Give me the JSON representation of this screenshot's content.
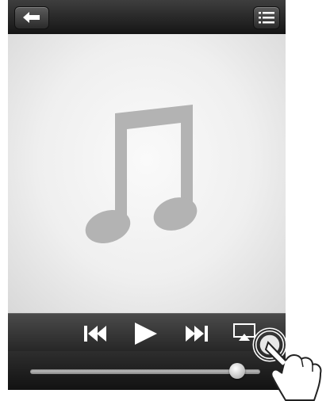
{
  "player": {
    "volume_level": 0.9
  },
  "icons": {
    "back": "back-arrow-icon",
    "menu": "list-menu-icon",
    "artwork": "music-note-icon",
    "previous": "previous-track-icon",
    "play": "play-icon",
    "next": "next-track-icon",
    "airplay": "airplay-icon"
  },
  "colors": {
    "bar_dark": "#1a1a1a",
    "artwork_bg": "#efefef",
    "note": "#b3b3b3",
    "control_icon": "#ffffff"
  }
}
